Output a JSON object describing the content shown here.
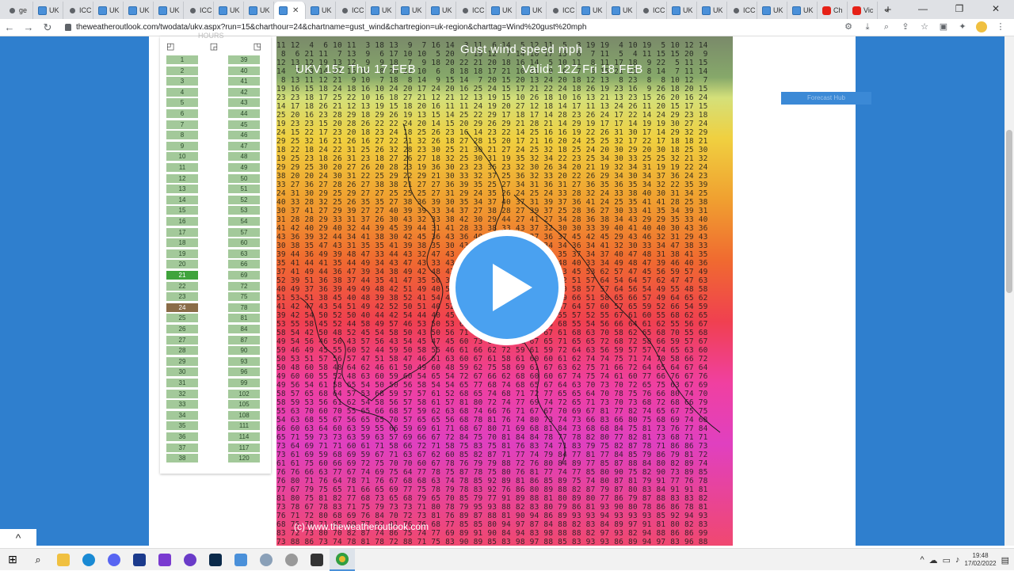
{
  "browser": {
    "tabs": [
      {
        "label": "ge",
        "icon": "globe-icon"
      },
      {
        "label": "UK",
        "icon": "uk-site-icon"
      },
      {
        "label": "ICC",
        "icon": "globe-icon"
      },
      {
        "label": "UK",
        "icon": "uk-site-icon"
      },
      {
        "label": "UK",
        "icon": "uk-site-icon"
      },
      {
        "label": "UK",
        "icon": "uk-site-icon"
      },
      {
        "label": "ICC",
        "icon": "globe-icon"
      },
      {
        "label": "UK",
        "icon": "uk-site-icon"
      },
      {
        "label": "UK",
        "icon": "uk-site-icon"
      },
      {
        "label": "",
        "icon": "uk-site-icon",
        "active": true
      },
      {
        "label": "UK",
        "icon": "uk-site-icon"
      },
      {
        "label": "ICC",
        "icon": "globe-icon"
      },
      {
        "label": "UK",
        "icon": "uk-site-icon"
      },
      {
        "label": "UK",
        "icon": "uk-site-icon"
      },
      {
        "label": "UK",
        "icon": "uk-site-icon"
      },
      {
        "label": "ICC",
        "icon": "globe-icon"
      },
      {
        "label": "UK",
        "icon": "uk-site-icon"
      },
      {
        "label": "UK",
        "icon": "uk-site-icon"
      },
      {
        "label": "ICC",
        "icon": "globe-icon"
      },
      {
        "label": "UK",
        "icon": "uk-site-icon"
      },
      {
        "label": "UK",
        "icon": "uk-site-icon"
      },
      {
        "label": "ICC",
        "icon": "globe-icon"
      },
      {
        "label": "UK",
        "icon": "uk-site-icon"
      },
      {
        "label": "UK",
        "icon": "uk-site-icon"
      },
      {
        "label": "ICC",
        "icon": "globe-icon"
      },
      {
        "label": "UK",
        "icon": "uk-site-icon"
      },
      {
        "label": "UK",
        "icon": "uk-site-icon"
      },
      {
        "label": "Ch",
        "icon": "youtube-icon"
      },
      {
        "label": "Vic",
        "icon": "youtube-icon"
      }
    ],
    "new_tab_symbol": "+",
    "url": "theweatheroutlook.com/twodata/ukv.aspx?run=15&charthour=24&chartname=gust_wind&chartregion=uk-region&charttag=Wind%20gust%20mph"
  },
  "hours_panel": {
    "title": "HOURS",
    "col1": [
      "1",
      "2",
      "3",
      "4",
      "5",
      "6",
      "7",
      "8",
      "9",
      "10",
      "11",
      "12",
      "13",
      "14",
      "15",
      "16",
      "17",
      "18",
      "19",
      "20",
      "21",
      "22",
      "23",
      "24",
      "25",
      "26",
      "27",
      "28",
      "29",
      "30",
      "31",
      "32",
      "33",
      "34",
      "35",
      "36",
      "37",
      "38"
    ],
    "col2": [
      "39",
      "40",
      "41",
      "42",
      "43",
      "44",
      "45",
      "46",
      "47",
      "48",
      "49",
      "50",
      "51",
      "52",
      "53",
      "54",
      "57",
      "60",
      "63",
      "66",
      "69",
      "72",
      "75",
      "78",
      "81",
      "84",
      "87",
      "90",
      "93",
      "96",
      "99",
      "102",
      "105",
      "108",
      "111",
      "114",
      "117",
      "120"
    ],
    "highlight_current": "21",
    "highlight_selected": "24"
  },
  "chart": {
    "title": "Gust wind speed mph",
    "run": "UKV 15z Thu 17 FEB",
    "valid": "Valid: 12Z Fri 18 FEB",
    "credit": "(c) www.theweatheroutlook.com"
  },
  "side_button": "Forecast Hub",
  "scroll_up": "^",
  "taskbar": {
    "clock_time": "19:48",
    "clock_date": "17/02/2022"
  }
}
